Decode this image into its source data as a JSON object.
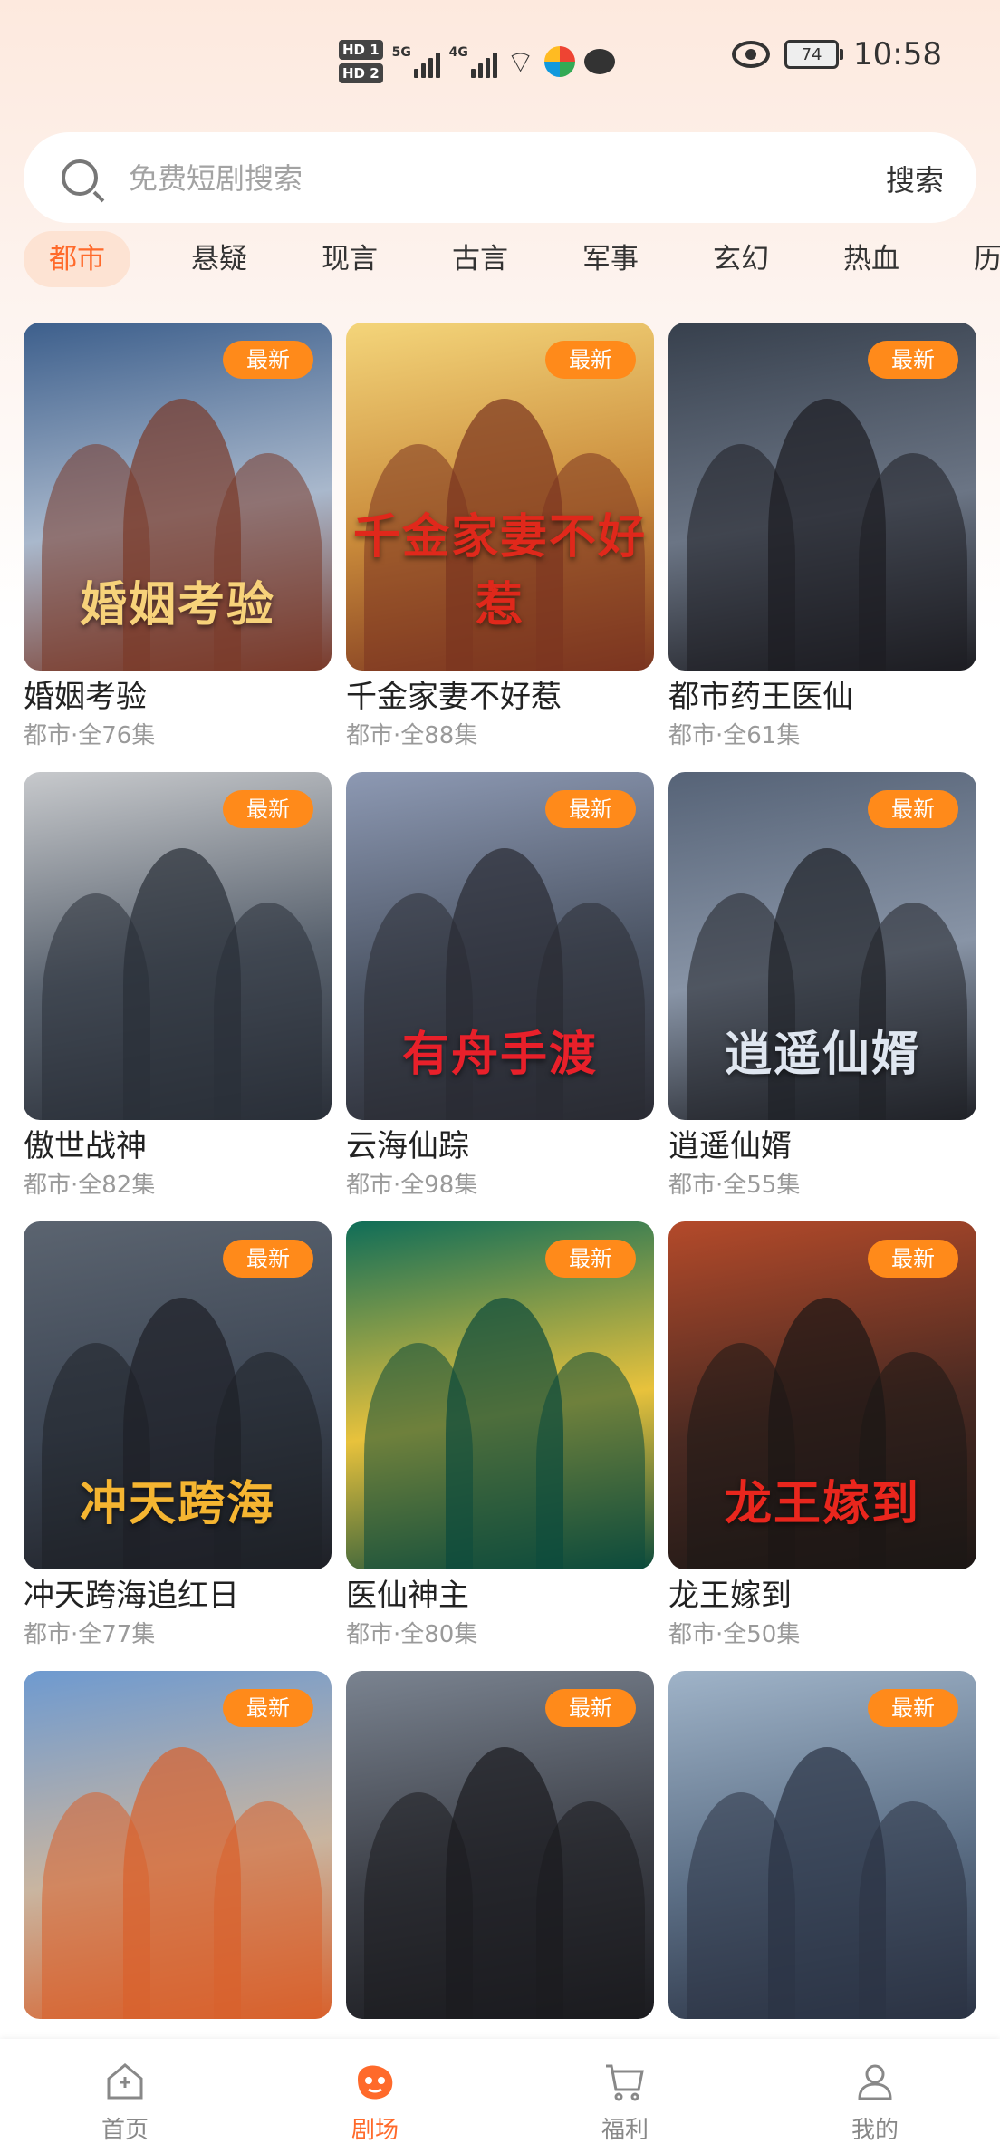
{
  "status_bar": {
    "hd1": "HD 1",
    "hd2": "HD 2",
    "net1": "5G",
    "net2": "4G",
    "battery": "74",
    "time": "10:58"
  },
  "search": {
    "placeholder": "免费短剧搜索",
    "button": "搜索"
  },
  "categories": [
    "都市",
    "悬疑",
    "现言",
    "古言",
    "军事",
    "玄幻",
    "热血",
    "历史"
  ],
  "active_category": "都市",
  "badge_label": "最新",
  "dramas": [
    {
      "title": "婚姻考验",
      "poster_title": "婚姻考验",
      "meta": "都市·全76集",
      "colors": [
        "#3d5f8c",
        "#a9b8cc",
        "#7a3a2a"
      ],
      "title_color": "#f7d27a"
    },
    {
      "title": "千金家妻不好惹",
      "poster_title": "千金家妻不好惹",
      "meta": "都市·全88集",
      "colors": [
        "#f4d57a",
        "#c98a3a",
        "#7b3520"
      ],
      "title_color": "#e0281b"
    },
    {
      "title": "都市药王医仙",
      "poster_title": "",
      "meta": "都市·全61集",
      "colors": [
        "#37404d",
        "#6b7585",
        "#1d1d22"
      ],
      "title_color": "#ffffff"
    },
    {
      "title": "傲世战神",
      "poster_title": "",
      "meta": "都市·全82集",
      "colors": [
        "#c7c9cc",
        "#5b6470",
        "#2a2f38"
      ],
      "title_color": "#ffffff"
    },
    {
      "title": "云海仙踪",
      "poster_title": "有舟手渡",
      "meta": "都市·全98集",
      "colors": [
        "#8d99b3",
        "#4d5666",
        "#2a2b33"
      ],
      "title_color": "#e8202a"
    },
    {
      "title": "逍遥仙婿",
      "poster_title": "逍遥仙婿",
      "meta": "都市·全55集",
      "colors": [
        "#566377",
        "#8894a6",
        "#202228"
      ],
      "title_color": "#dfe6f0"
    },
    {
      "title": "冲天跨海追红日",
      "poster_title": "冲天跨海",
      "meta": "都市·全77集",
      "colors": [
        "#5b6470",
        "#3d4654",
        "#1e2026"
      ],
      "title_color": "#f5b531"
    },
    {
      "title": "医仙神主",
      "poster_title": "",
      "meta": "都市·全80集",
      "colors": [
        "#0f6d58",
        "#e8c23c",
        "#0b4a3c"
      ],
      "title_color": "#ffffff"
    },
    {
      "title": "龙王嫁到",
      "poster_title": "龙王嫁到",
      "meta": "都市·全50集",
      "colors": [
        "#b44a2a",
        "#4b2a22",
        "#1c1715"
      ],
      "title_color": "#e9261d"
    },
    {
      "title": "",
      "poster_title": "",
      "meta": "",
      "colors": [
        "#6e9ad0",
        "#c9b5a0",
        "#d8612c"
      ],
      "title_color": "#ffffff"
    },
    {
      "title": "",
      "poster_title": "",
      "meta": "",
      "colors": [
        "#7a8390",
        "#3d4048",
        "#1b1b1f"
      ],
      "title_color": "#e8a62a"
    },
    {
      "title": "",
      "poster_title": "",
      "meta": "",
      "colors": [
        "#9fb3c8",
        "#5c6f86",
        "#2b3344"
      ],
      "title_color": "#ffffff"
    }
  ],
  "bottom_nav": [
    {
      "label": "首页",
      "icon": "home-icon"
    },
    {
      "label": "剧场",
      "icon": "theater-icon"
    },
    {
      "label": "福利",
      "icon": "cart-icon"
    },
    {
      "label": "我的",
      "icon": "profile-icon"
    }
  ],
  "active_nav": "剧场",
  "accent_color": "#ff6a2b",
  "badge_color": "#ff8a1a"
}
